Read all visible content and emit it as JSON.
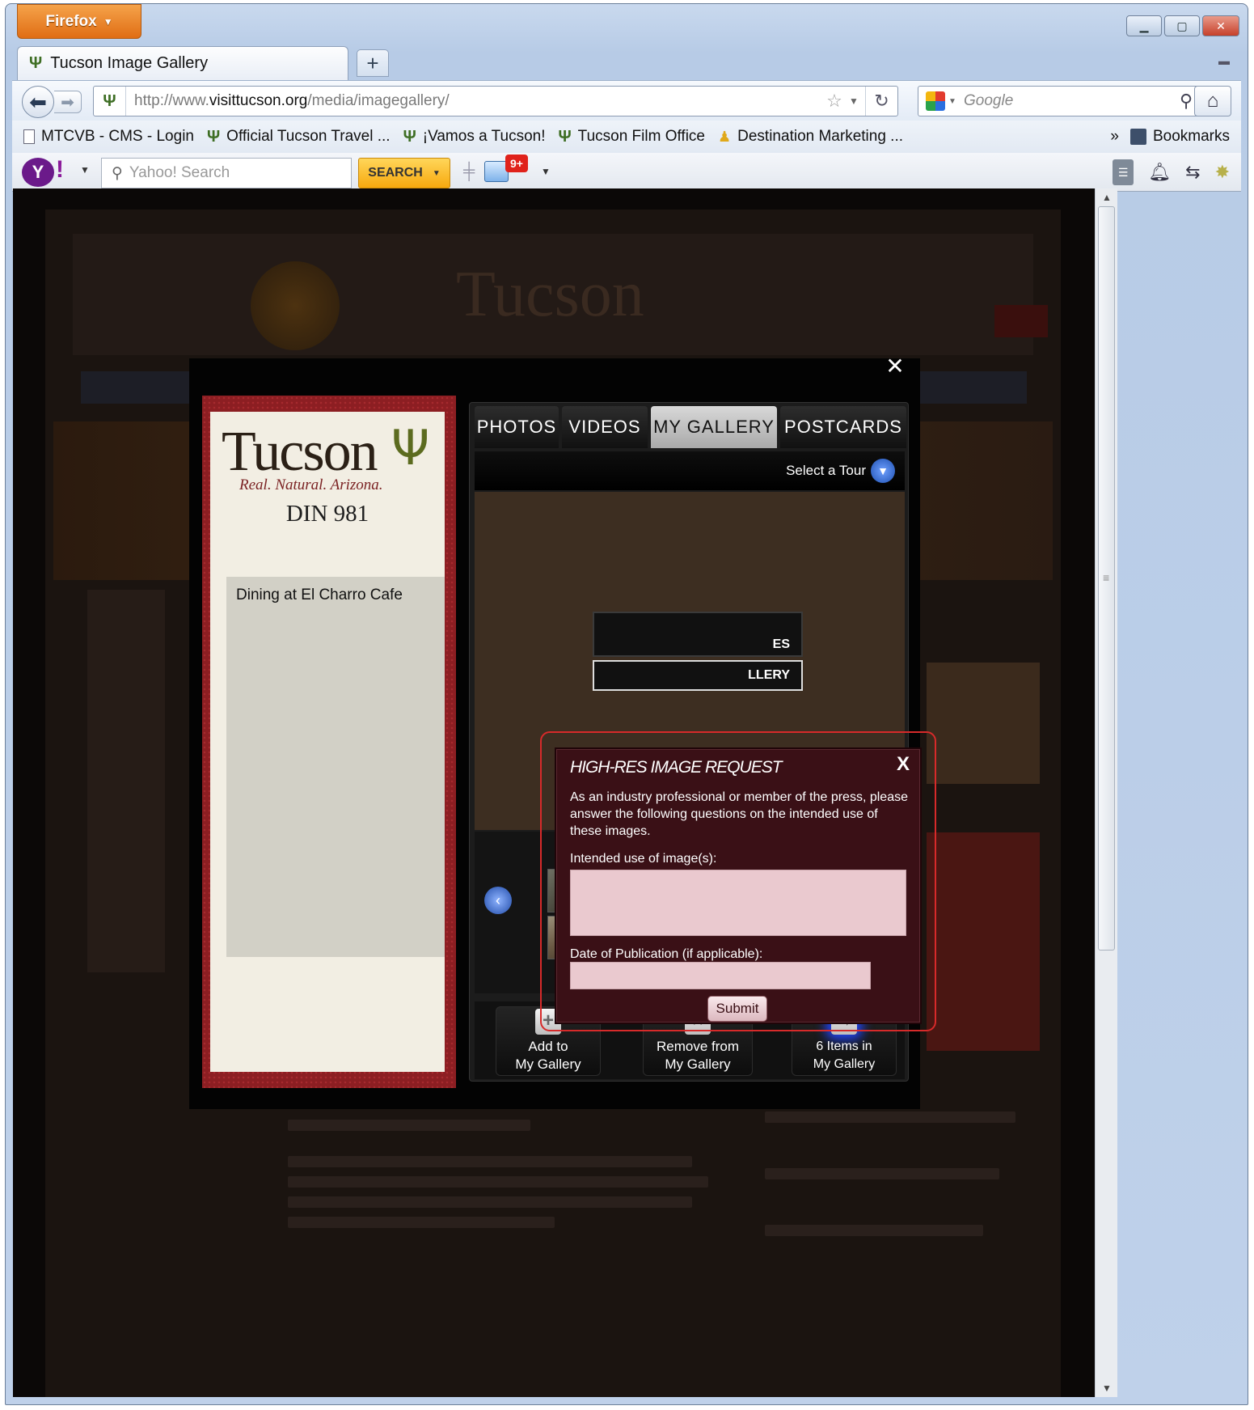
{
  "browser": {
    "app_button": "Firefox",
    "tab_title": "Tucson Image Gallery",
    "new_tab": "+",
    "url_prefix": "http://www.",
    "url_domain": "visittucson.org",
    "url_path": "/media/imagegallery/",
    "search_placeholder": "Google",
    "bookmarks": [
      {
        "label": "MTCVB - CMS - Login",
        "icon": "page-icon"
      },
      {
        "label": "Official Tucson Travel ...",
        "icon": "cactus-icon"
      },
      {
        "label": "¡Vamos a Tucson!",
        "icon": "cactus-icon"
      },
      {
        "label": "Tucson Film Office",
        "icon": "cactus-icon"
      },
      {
        "label": "Destination Marketing ...",
        "icon": "person-icon"
      }
    ],
    "bookmarks_overflow": "»",
    "bookmarks_menu": "Bookmarks"
  },
  "yahoo_toolbar": {
    "search_placeholder": "Yahoo! Search",
    "search_button": "SEARCH",
    "mail_badge": "9+"
  },
  "gallery": {
    "logo_word": "Tucson",
    "logo_tagline": "Real. Natural. Arizona.",
    "image_id": "DIN 981",
    "caption": "Dining at El Charro Cafe",
    "tabs": [
      "PHOTOS",
      "VIDEOS",
      "MY GALLERY",
      "POSTCARDS"
    ],
    "active_tab": "MY GALLERY",
    "tour_label": "Select a Tour",
    "stage_button_1_partial": "ES",
    "stage_button_2_partial": "LLERY",
    "actions": [
      {
        "line1": "Add to",
        "line2": "My Gallery",
        "icon": "plus-icon"
      },
      {
        "line1": "Remove from",
        "line2": "My Gallery",
        "icon": "x-icon"
      },
      {
        "line1": "6 Items in",
        "line2": "My Gallery",
        "icon": "arrow-icon"
      }
    ]
  },
  "modal": {
    "title": "HIGH-RES IMAGE REQUEST",
    "close": "X",
    "intro": "As an industry professional or member of the press, please answer the following questions on the intended use of these images.",
    "intended_use_label": "Intended use of image(s):",
    "intended_use_value": "",
    "date_label": "Date of Publication (if applicable):",
    "date_value": "",
    "submit": "Submit"
  },
  "colors": {
    "modal_bg": "#3a1016",
    "field_bg": "#eac9cf",
    "highlight": "#d72a2a",
    "active_tab": "#c4c4c4",
    "left_panel": "#8c1e22"
  }
}
